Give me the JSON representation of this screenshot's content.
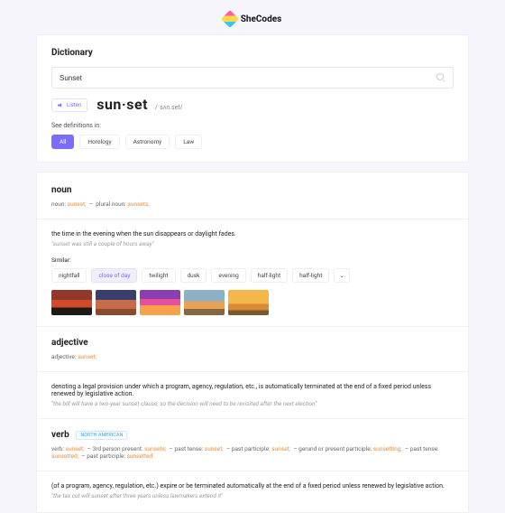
{
  "brand": {
    "name": "SheCodes"
  },
  "header": {
    "title": "Dictionary"
  },
  "search": {
    "value": "Sunset",
    "placeholder": "Search"
  },
  "listen": {
    "label": "Listen"
  },
  "headword": {
    "display": "sun·set",
    "pronunciation": "/ˈsʌn.set/"
  },
  "see_in": {
    "label": "See definitions in:"
  },
  "filters": [
    {
      "label": "All",
      "active": true
    },
    {
      "label": "Horology",
      "active": false
    },
    {
      "label": "Astronomy",
      "active": false
    },
    {
      "label": "Law",
      "active": false
    }
  ],
  "noun": {
    "pos": "noun",
    "forms_prefix1": "noun: ",
    "forms_word1": "sunset;",
    "forms_prefix2": "plural noun: ",
    "forms_word2": "sunsets;",
    "definition": "the time in the evening when the sun disappears or daylight fades.",
    "example": "\"sunset was still a couple of hours away\"",
    "similar_label": "Similar:",
    "similar": [
      "nightfall",
      "close of day",
      "twilight",
      "dusk",
      "evening",
      "half-light",
      "half-light"
    ],
    "similar_selected_index": 1,
    "more_glyph": "⌄"
  },
  "adjective": {
    "pos": "adjective",
    "forms_prefix": "adjective: ",
    "forms_word": "sunset;",
    "definition": "denoting a legal provision under which a program, agency, regulation, etc., is automatically terminated at the end of a fixed period unless renewed by legislative action.",
    "example": "\"the bill will have a two-year sunset clause, so the decision will need to be revisited after the next election\""
  },
  "verb": {
    "pos": "verb",
    "region": "NORTH AMERICAN",
    "forms_html_parts": {
      "p1": "verb: ",
      "w1": "sunset;",
      "p2": "3rd person present: ",
      "w2": "sunsets;",
      "p3": "past tense: ",
      "w3": "sunset;",
      "p4": "past participle: ",
      "w4": "sunset;",
      "p5": "gerund or present participle: ",
      "w5": "sunsetting;",
      "p6": "past tense: ",
      "w6": "sunsetted;",
      "p7": "past participle: ",
      "w7": "sunsetted"
    },
    "definition": "(of a program, agency, regulation, etc.) expire or be terminated automatically at the end of a fixed period unless renewed by legislative action.",
    "example": "\"the tax cut will sunset after three years unless lawmakers extend it\""
  }
}
